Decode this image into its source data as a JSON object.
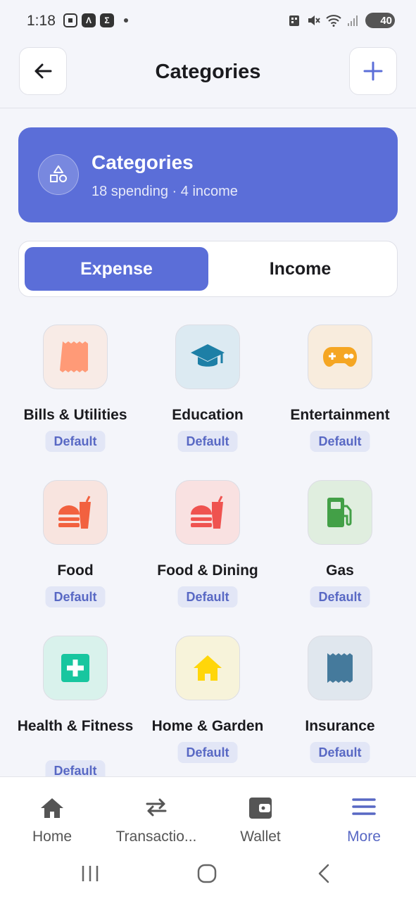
{
  "status_bar": {
    "time": "1:18",
    "battery": "40",
    "left_icons": [
      "screenshot-icon",
      "a-icon",
      "sigma-icon"
    ],
    "right_icons": [
      "lock-icon",
      "mute-icon",
      "wifi-icon",
      "signal-icon"
    ]
  },
  "header": {
    "title": "Categories",
    "back_icon": "arrow-left-icon",
    "add_icon": "plus-icon"
  },
  "summary": {
    "title": "Categories",
    "subtitle": "18 spending · 4 income",
    "icon": "shapes-icon"
  },
  "toggle": {
    "expense": "Expense",
    "income": "Income",
    "selected": "Expense"
  },
  "categories": [
    {
      "name": "Bills & Utilities",
      "badge": "Default",
      "icon": "receipt-icon",
      "tile_bg": "#f8ebe6",
      "color": "#ff9a77"
    },
    {
      "name": "Education",
      "badge": "Default",
      "icon": "graduation-cap-icon",
      "tile_bg": "#dceaf2",
      "color": "#1d7fa6"
    },
    {
      "name": "Entertainment",
      "badge": "Default",
      "icon": "gamepad-icon",
      "tile_bg": "#f8ecdd",
      "color": "#f5a623"
    },
    {
      "name": "Food",
      "badge": "Default",
      "icon": "fastfood-icon",
      "tile_bg": "#f8e4df",
      "color": "#f2613f"
    },
    {
      "name": "Food & Dining",
      "badge": "Default",
      "icon": "fastfood-icon",
      "tile_bg": "#f9e1e1",
      "color": "#ef5350"
    },
    {
      "name": "Gas",
      "badge": "Default",
      "icon": "gas-pump-icon",
      "tile_bg": "#e0eedf",
      "color": "#43a047"
    },
    {
      "name": "Health & Fitness",
      "badge": "Default",
      "icon": "medical-cross-icon",
      "tile_bg": "#d9f2ec",
      "color": "#18c69f"
    },
    {
      "name": "Home & Garden",
      "badge": "Default",
      "icon": "house-icon",
      "tile_bg": "#f7f3da",
      "color": "#ffd60a"
    },
    {
      "name": "Insurance",
      "badge": "Default",
      "icon": "receipt-icon",
      "tile_bg": "#e0e7ee",
      "color": "#457a9c"
    }
  ],
  "bottom_nav": [
    {
      "label": "Home",
      "icon": "home-icon",
      "active": false
    },
    {
      "label": "Transactio...",
      "icon": "swap-arrows-icon",
      "active": false
    },
    {
      "label": "Wallet",
      "icon": "wallet-icon",
      "active": false
    },
    {
      "label": "More",
      "icon": "menu-icon",
      "active": true
    }
  ],
  "colors": {
    "accent": "#5b6ed8",
    "badge_bg": "#e2e6f6",
    "badge_text": "#5868c4",
    "background": "#f4f5fa"
  }
}
